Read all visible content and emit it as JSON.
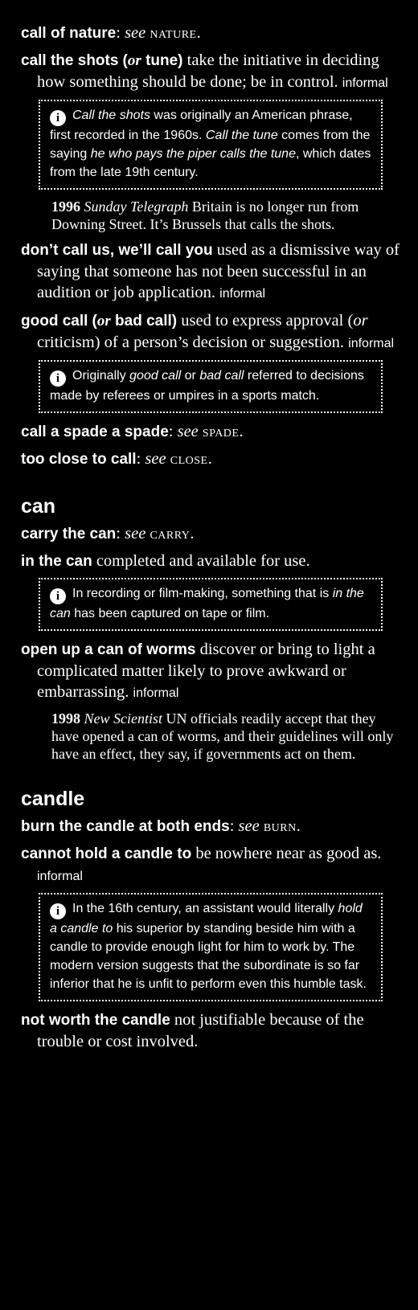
{
  "entries_a": {
    "e1": {
      "hw": "call of nature",
      "colon": ":",
      "see": "see",
      "xref": "nature."
    },
    "e2": {
      "hw1": "call the shots",
      "or": "or",
      "hw2": "tune",
      "def": "take the initiative in deciding how something should be done; be in control.",
      "reg": "informal"
    },
    "n1": {
      "t1": "Call the shots",
      "t2": " was originally an American phrase, first recorded in the 1960s. ",
      "t3": "Call the tune",
      "t4": " comes from the saying ",
      "t5": "he who pays the piper calls the tune",
      "t6": ", which dates from the late 19th century."
    },
    "q1": {
      "yr": "1996",
      "src": "Sunday Telegraph",
      "txt": "Britain is no longer run from Downing Street. It’s Brussels that calls the shots."
    },
    "e3": {
      "hw": "don’t call us, we’ll call you",
      "def": "used as a dismissive way of saying that someone has not been successful in an audition or job application.",
      "reg": "informal"
    },
    "e4": {
      "hw1": "good call",
      "or": "or",
      "hw2": "bad call",
      "def1": "used to express approval (",
      "or2": "or",
      "def2": "criticism) of a person’s decision or suggestion.",
      "reg": "informal"
    },
    "n2": {
      "t1": "Originally ",
      "t2": "good call",
      "t3": " or ",
      "t4": "bad call",
      "t5": " referred to decisions made by referees or umpires in a sports match."
    },
    "e5": {
      "hw": "call a spade a spade",
      "colon": ":",
      "see": "see",
      "xref": "spade."
    },
    "e6": {
      "hw": "too close to call",
      "colon": ":",
      "see": "see",
      "xref": "close."
    }
  },
  "can": {
    "head": "can",
    "e1": {
      "hw": "carry the can",
      "colon": ":",
      "see": "see",
      "xref": "carry."
    },
    "e2": {
      "hw": "in the can",
      "def": "completed and available for use."
    },
    "n1": {
      "t1": "In recording or film-making, something that is ",
      "t2": "in the can",
      "t3": " has been captured on tape or film."
    },
    "e3": {
      "hw": "open up a can of worms",
      "def": "discover or bring to light a complicated matter likely to prove awkward or embarrassing.",
      "reg": "informal"
    },
    "q1": {
      "yr": "1998",
      "src": "New Scientist",
      "txt": "UN officials readily accept that they have opened a can of worms, and their guidelines will only have an effect, they say, if governments act on them."
    }
  },
  "candle": {
    "head": "candle",
    "e1": {
      "hw": "burn the candle at both ends",
      "colon": ":",
      "see": "see",
      "xref": "burn."
    },
    "e2": {
      "hw": "cannot hold a candle to",
      "def": "be nowhere near as good as.",
      "reg": "informal"
    },
    "n1": {
      "t1": "In the 16th century, an assistant would literally ",
      "t2": "hold a candle to",
      "t3": " his superior by standing beside him with a candle to provide enough light for him to work by. The modern version suggests that the subordinate is so far inferior that he is unfit to perform even this humble task."
    },
    "e3": {
      "hw": "not worth the candle",
      "def": "not justifiable because of the trouble or cost involved."
    }
  },
  "icons": {
    "info": "i"
  },
  "colors": {
    "background": "#000000",
    "text": "#ffffff"
  }
}
